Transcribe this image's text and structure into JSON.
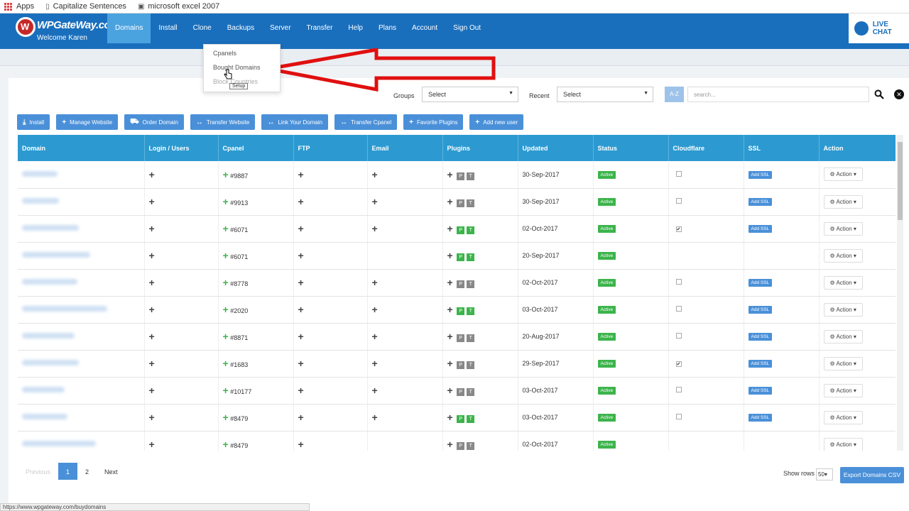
{
  "bookmarks": {
    "apps": "Apps",
    "item1": "Capitalize Sentences",
    "item2": "microsoft excel 2007"
  },
  "brand": {
    "name": "WPGateWay.com",
    "welcome": "Welcome Karen"
  },
  "nav": [
    "Domains",
    "Install",
    "Clone",
    "Backups",
    "Server",
    "Transfer",
    "Help",
    "Plans",
    "Account",
    "Sign Out"
  ],
  "live_chat": "LIVE CHAT",
  "dropdown": {
    "cpanels": "Cpanels",
    "bought": "Bought Domains",
    "block": "Block Countries",
    "tooltip": "Setup"
  },
  "filters": {
    "groups_label": "Groups",
    "groups_value": "Select",
    "recent_label": "Recent",
    "recent_value": "Select",
    "az": "A-Z",
    "search_placeholder": "search..."
  },
  "actions": [
    "Install",
    "Manage Website",
    "Order Domain",
    "Transfer Website",
    "Link Your Domain",
    "Transfer Cpanel",
    "Favorite Plugins",
    "Add new user"
  ],
  "table": {
    "headers": [
      "Domain",
      "Login / Users",
      "Cpanel",
      "FTP",
      "Email",
      "Plugins",
      "Updated",
      "Status",
      "Cloudflare",
      "SSL",
      "Action"
    ],
    "rows": [
      {
        "cpanel": "#9887",
        "email": true,
        "p_green": false,
        "updated": "30-Sep-2017",
        "cf": "off",
        "ssl": true
      },
      {
        "cpanel": "#9913",
        "email": true,
        "p_green": false,
        "updated": "30-Sep-2017",
        "cf": "off",
        "ssl": true
      },
      {
        "cpanel": "#6071",
        "email": true,
        "p_green": true,
        "updated": "02-Oct-2017",
        "cf": "on",
        "ssl": true
      },
      {
        "cpanel": "#6071",
        "email": false,
        "p_green": true,
        "updated": "20-Sep-2017",
        "cf": "none",
        "ssl": false
      },
      {
        "cpanel": "#8778",
        "email": true,
        "p_green": false,
        "updated": "02-Oct-2017",
        "cf": "off",
        "ssl": true
      },
      {
        "cpanel": "#2020",
        "email": true,
        "p_green": true,
        "updated": "03-Oct-2017",
        "cf": "off",
        "ssl": true
      },
      {
        "cpanel": "#8871",
        "email": true,
        "p_green": false,
        "updated": "20-Aug-2017",
        "cf": "off",
        "ssl": true
      },
      {
        "cpanel": "#1683",
        "email": true,
        "p_green": false,
        "updated": "29-Sep-2017",
        "cf": "on",
        "ssl": true
      },
      {
        "cpanel": "#10177",
        "email": true,
        "p_green": false,
        "updated": "03-Oct-2017",
        "cf": "off",
        "ssl": true
      },
      {
        "cpanel": "#8479",
        "email": true,
        "p_green": true,
        "updated": "03-Oct-2017",
        "cf": "off",
        "ssl": true
      },
      {
        "cpanel": "#8479",
        "email": false,
        "p_green": false,
        "updated": "02-Oct-2017",
        "cf": "none",
        "ssl": false
      }
    ],
    "status_label": "Active",
    "ssl_label": "Add SSL",
    "action_label": "Action",
    "p_letter": "P",
    "t_letter": "T"
  },
  "pager": {
    "prev": "Previous",
    "pages": [
      "1",
      "2"
    ],
    "next": "Next"
  },
  "show_rows": {
    "label": "Show rows",
    "value": "50"
  },
  "export": "Export Domains CSV",
  "status_url": "https://www.wpgateway.com/buydomains",
  "colors": {
    "nav_blue": "#1a6fbd",
    "active_tab": "#4aa3df",
    "table_header": "#2c9ad1",
    "status_green": "#3cb44b",
    "arrow_red": "#e01010"
  }
}
